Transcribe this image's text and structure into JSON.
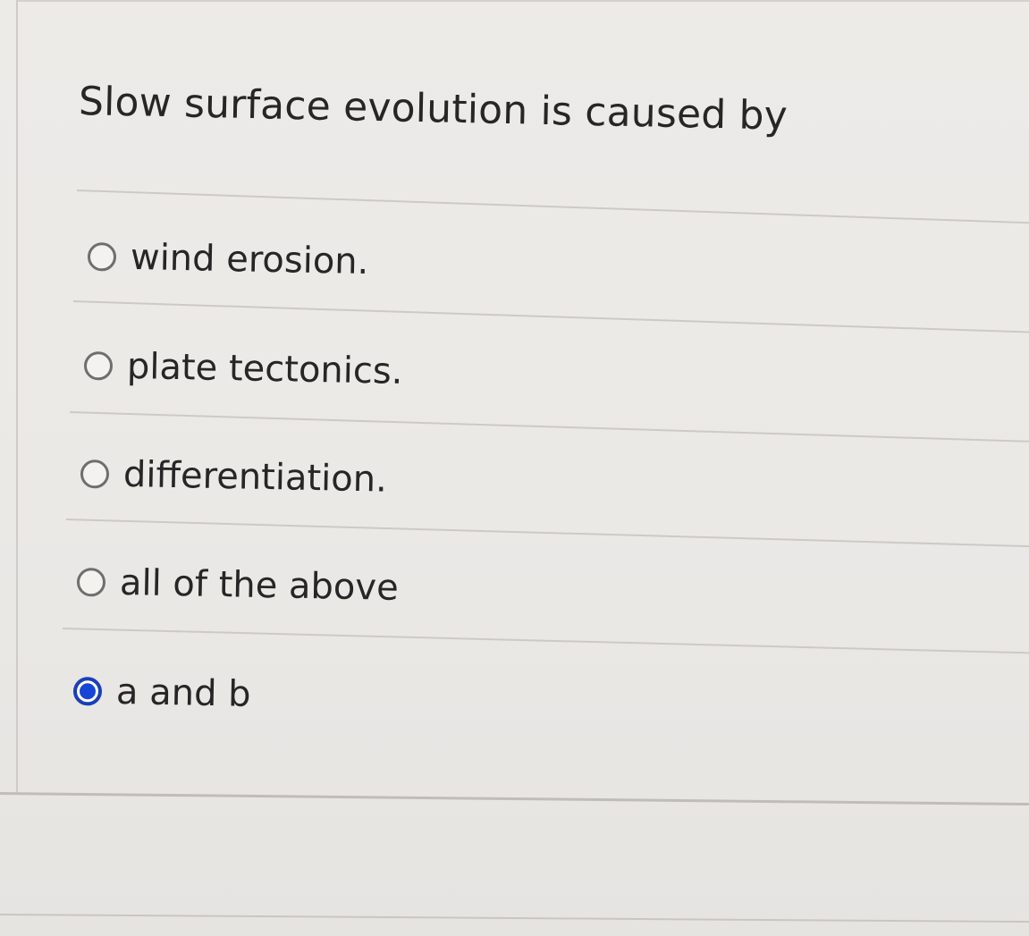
{
  "question": {
    "text": "Slow surface evolution is caused by"
  },
  "options": [
    {
      "label": "wind erosion.",
      "selected": false
    },
    {
      "label": "plate tectonics.",
      "selected": false
    },
    {
      "label": "differentiation.",
      "selected": false
    },
    {
      "label": "all of the above",
      "selected": false
    },
    {
      "label": "a and b",
      "selected": true
    }
  ],
  "colors": {
    "selected_radio": "#1646d6",
    "text": "#262626",
    "background": "#ebe9e6"
  }
}
